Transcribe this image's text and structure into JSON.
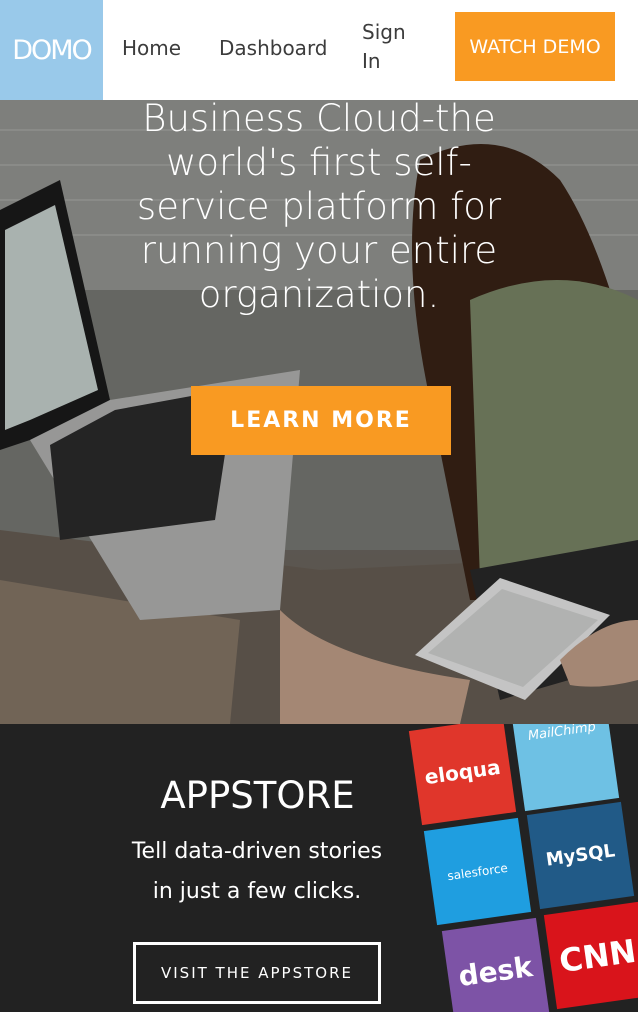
{
  "nav": {
    "logo_text": "DOMO",
    "links": [
      "Home",
      "Dashboard",
      "Sign In"
    ],
    "cta_label": "WATCH DEMO"
  },
  "hero": {
    "headline_lines": [
      "Business Cloud-the",
      "world's first self-",
      "service platform for",
      "running your entire",
      "organization."
    ],
    "cta_label": "LEARN MORE"
  },
  "appstore": {
    "title": "APPSTORE",
    "subtitle_lines": [
      "Tell data-driven stories",
      "in just a few clicks."
    ],
    "cta_label": "VISIT THE APPSTORE",
    "tiles": [
      {
        "label": "eloqua",
        "color": "#e0362b"
      },
      {
        "label": "MailChimp",
        "color": "#6ec1e4"
      },
      {
        "label": "salesforce",
        "color": "#1f9ee0"
      },
      {
        "label": "MySQL",
        "color": "#215a87"
      },
      {
        "label": "desk",
        "color": "#7d53a6"
      },
      {
        "label": "CNN",
        "color": "#d9141b"
      }
    ]
  },
  "colors": {
    "accent": "#f99a22",
    "logo_bg": "#99c9ea",
    "appstore_bg": "#222222"
  }
}
